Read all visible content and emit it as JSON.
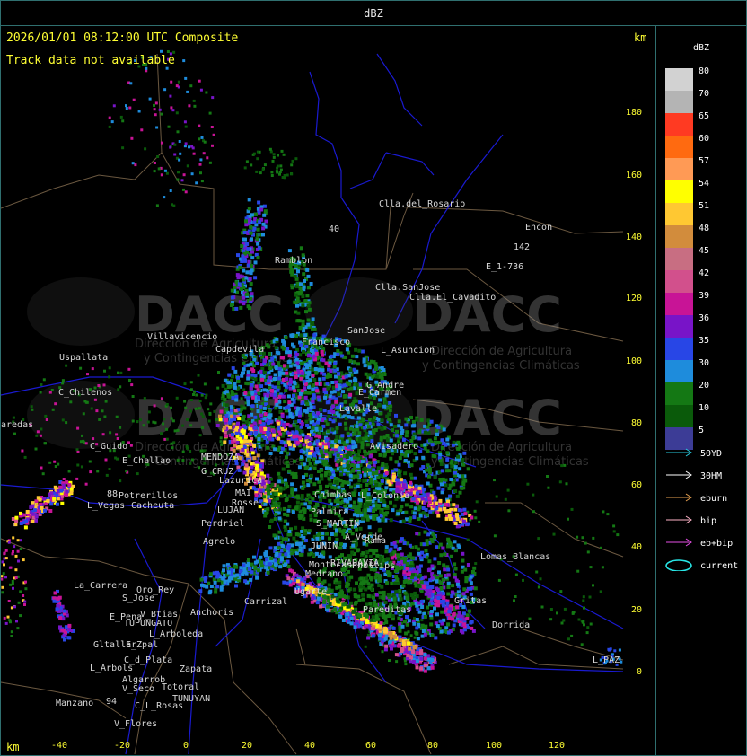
{
  "title": "dBZ",
  "timestamp": "2026/01/01 08:12:00 UTC Composite",
  "track_status": "Track data not available",
  "axis_unit": "km",
  "x_ticks": [
    "-40",
    "-20",
    "0",
    "20",
    "40",
    "60",
    "80",
    "100",
    "120"
  ],
  "y_ticks": [
    "180",
    "160",
    "140",
    "120",
    "100",
    "80",
    "60",
    "40",
    "20",
    "0"
  ],
  "watermark": {
    "logo_text": "DACC",
    "line1": "Dirección de Agricultura",
    "line2": "y Contingencias Climáticas"
  },
  "legend": {
    "title": "dBZ",
    "scale": [
      {
        "label": "80",
        "color": "#d2d2d2"
      },
      {
        "label": "70",
        "color": "#b4b4b4"
      },
      {
        "label": "65",
        "color": "#ff3a22"
      },
      {
        "label": "60",
        "color": "#ff6a10"
      },
      {
        "label": "57",
        "color": "#ff9a55"
      },
      {
        "label": "54",
        "color": "#ffff00"
      },
      {
        "label": "51",
        "color": "#ffc832"
      },
      {
        "label": "48",
        "color": "#d28c3c"
      },
      {
        "label": "45",
        "color": "#c86e82"
      },
      {
        "label": "42",
        "color": "#d2508c"
      },
      {
        "label": "39",
        "color": "#c81496"
      },
      {
        "label": "36",
        "color": "#7814c8"
      },
      {
        "label": "35",
        "color": "#2846e6"
      },
      {
        "label": "30",
        "color": "#1e8cdc"
      },
      {
        "label": "20",
        "color": "#147814"
      },
      {
        "label": "10",
        "color": "#0a5a0a"
      },
      {
        "label": "5",
        "color": "#3c3c96"
      }
    ],
    "tracks": [
      {
        "label": "50YD",
        "color": "#28c8dc"
      },
      {
        "label": "30HM",
        "color": "#ffffff"
      },
      {
        "label": "eburn",
        "color": "#e6a050"
      },
      {
        "label": "bip",
        "color": "#ffb4c8"
      },
      {
        "label": "eb+bip",
        "color": "#e650e6"
      },
      {
        "label": "current",
        "color": "#28e6e6"
      }
    ]
  },
  "cities": [
    {
      "name": "Clla.del_Rosario"
    },
    {
      "name": "Encon"
    },
    {
      "name": "142"
    },
    {
      "name": "E_1-736"
    },
    {
      "name": "Ramblon"
    },
    {
      "name": "Clla.SanJose"
    },
    {
      "name": "Clla.El_Cavadito"
    },
    {
      "name": "40"
    },
    {
      "name": "Villavicencio"
    },
    {
      "name": "Capdevila"
    },
    {
      "name": "Francisco"
    },
    {
      "name": "SanJose"
    },
    {
      "name": "L_Asuncion"
    },
    {
      "name": "Uspallata"
    },
    {
      "name": "C_Chilenos"
    },
    {
      "name": "E_Carmen"
    },
    {
      "name": "G_Andre"
    },
    {
      "name": "Lavalle"
    },
    {
      "name": "aredas"
    },
    {
      "name": "C_Guido"
    },
    {
      "name": "E_Challao"
    },
    {
      "name": "MENDOZA"
    },
    {
      "name": "G_CRUZ"
    },
    {
      "name": "Lazurica"
    },
    {
      "name": "Avisadero"
    },
    {
      "name": "88"
    },
    {
      "name": "Potrerillos"
    },
    {
      "name": "L_Vegas"
    },
    {
      "name": "Cacheuta"
    },
    {
      "name": "MAI"
    },
    {
      "name": "Rosse"
    },
    {
      "name": "LUJAN"
    },
    {
      "name": "Perdriel"
    },
    {
      "name": "Chimbas"
    },
    {
      "name": "Palmira"
    },
    {
      "name": "S_MARTIN"
    },
    {
      "name": "L_Colonia"
    },
    {
      "name": "Agrelo"
    },
    {
      "name": "JUNIN"
    },
    {
      "name": "A_Verde"
    },
    {
      "name": "Rama"
    },
    {
      "name": "Lomas_Blancas"
    },
    {
      "name": "RIVADAVIA"
    },
    {
      "name": "Phillips"
    },
    {
      "name": "La_Carrera"
    },
    {
      "name": "Oro_Rey"
    },
    {
      "name": "S_Jose"
    },
    {
      "name": "Anchoris"
    },
    {
      "name": "Carrizal"
    },
    {
      "name": "Ugarte"
    },
    {
      "name": "Montecaseros"
    },
    {
      "name": "Medrano"
    },
    {
      "name": "Gritas"
    },
    {
      "name": "E_Pena"
    },
    {
      "name": "V_Btias"
    },
    {
      "name": "TUPUNGATO"
    },
    {
      "name": "L_Arboleda"
    },
    {
      "name": "Dorrida"
    },
    {
      "name": "Gltallar"
    },
    {
      "name": "E_Zpal"
    },
    {
      "name": "C_d_Plata"
    },
    {
      "name": "L_Arbols"
    },
    {
      "name": "Zapata"
    },
    {
      "name": "Algarrob"
    },
    {
      "name": "V_Seco"
    },
    {
      "name": "Totoral"
    },
    {
      "name": "TUNUYAN"
    },
    {
      "name": "Manzano"
    },
    {
      "name": "94"
    },
    {
      "name": "C_L_Rosas"
    },
    {
      "name": "V_Flores"
    },
    {
      "name": "L_PAZ"
    },
    {
      "name": "Pareditas"
    }
  ]
}
